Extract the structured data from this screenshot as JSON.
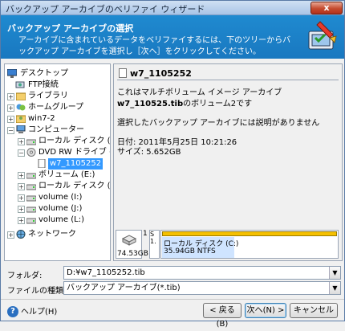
{
  "window": {
    "title": "バックアップ アーカイブのベリファイ ウィザード",
    "close_glyph": "x"
  },
  "banner": {
    "title": "バックアップ アーカイブの選択",
    "description": "アーカイブに含まれているデータをベリファイするには、下のツリーからバックアップ アーカイブを選択し［次へ］をクリックしてください。"
  },
  "tree": {
    "items": [
      {
        "label": "デスクトップ",
        "icon": "desktop-icon"
      },
      {
        "label": "FTP接続",
        "icon": "ftp-icon"
      },
      {
        "label": "ライブラリ",
        "icon": "library-icon"
      },
      {
        "label": "ホームグループ",
        "icon": "homegroup-icon"
      },
      {
        "label": "win7-2",
        "icon": "user-folder-icon"
      },
      {
        "label": "コンピューター",
        "icon": "computer-icon"
      },
      {
        "label": "ローカル ディスク (C:)",
        "icon": "hard-drive-icon"
      },
      {
        "label": "DVD RW ドライブ (D:) /",
        "icon": "dvd-drive-icon"
      },
      {
        "label": "w7_1105252",
        "icon": "archive-file-icon"
      },
      {
        "label": "ボリューム (E:)",
        "icon": "hard-drive-icon"
      },
      {
        "label": "ローカル ディスク (H:)",
        "icon": "hard-drive-icon"
      },
      {
        "label": "volume (I:)",
        "icon": "hard-drive-icon"
      },
      {
        "label": "volume (J:)",
        "icon": "hard-drive-icon"
      },
      {
        "label": "volume (L:)",
        "icon": "hard-drive-icon"
      },
      {
        "label": "ネットワーク",
        "icon": "network-icon"
      }
    ]
  },
  "info": {
    "name": "w7_1105252",
    "line1": "これはマルチボリューム イメージ アーカイブ",
    "line2_bold": "w7_110525.tib",
    "line2_rest": "のボリューム2です",
    "line3": "選択したバックアップ アーカイブには説明がありません",
    "date": "日付: 2011年5月25日 10:21:26",
    "size": "サイズ: 5.652GB"
  },
  "disk": {
    "size": "74.53GB",
    "number": "1",
    "small_part_label1": "S",
    "small_part_label2": "1.",
    "part_name": "ローカル ディスク (C:)",
    "part_info": "35.94GB  NTFS"
  },
  "form": {
    "folder_label": "フォルダ:",
    "folder_value": "D:¥w7_1105252.tib",
    "filetype_label": "ファイルの種類(T):",
    "filetype_value": "バックアップ アーカイブ(*.tib)"
  },
  "buttons": {
    "help": "ヘルプ(H)",
    "back": "< 戻る(B)",
    "next": "次へ(N) >",
    "cancel": "キャンセル"
  }
}
